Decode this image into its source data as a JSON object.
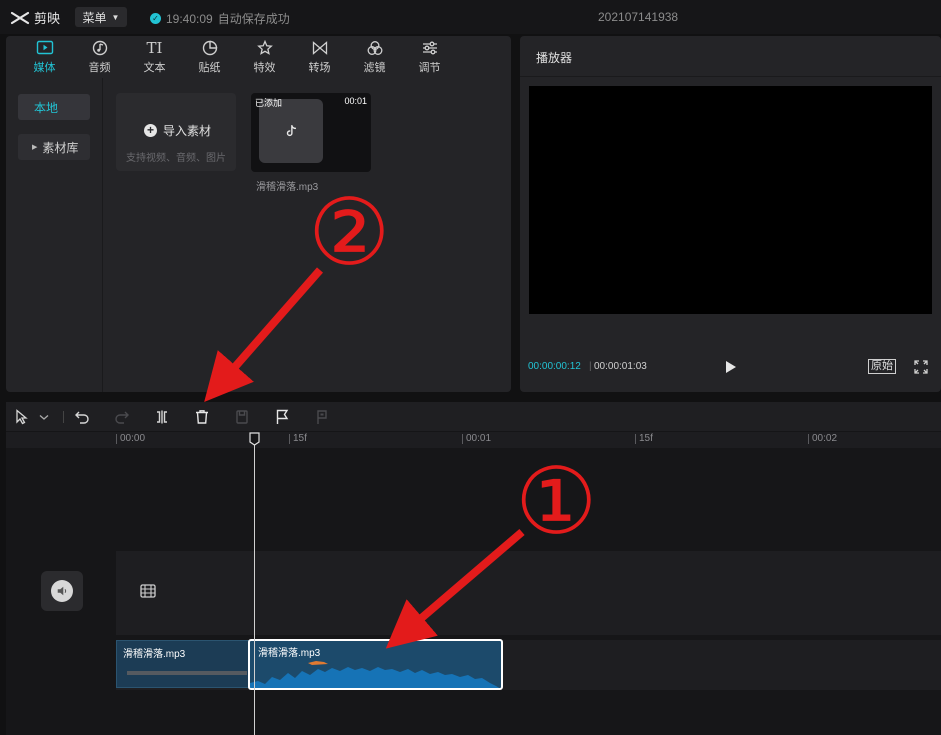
{
  "app": {
    "name": "剪映",
    "menu_label": "菜单",
    "save_time": "19:40:09",
    "save_text": "自动保存成功",
    "project_name": "202107141938"
  },
  "tabs": [
    {
      "label": "媒体",
      "icon": "media-icon",
      "active": true
    },
    {
      "label": "音频",
      "icon": "audio-icon",
      "active": false
    },
    {
      "label": "文本",
      "icon": "text-icon",
      "active": false
    },
    {
      "label": "贴纸",
      "icon": "sticker-icon",
      "active": false
    },
    {
      "label": "特效",
      "icon": "effects-icon",
      "active": false
    },
    {
      "label": "转场",
      "icon": "transition-icon",
      "active": false
    },
    {
      "label": "滤镜",
      "icon": "filter-icon",
      "active": false
    },
    {
      "label": "调节",
      "icon": "adjust-icon",
      "active": false
    }
  ],
  "sidebar": {
    "local": "本地",
    "library": "素材库"
  },
  "import": {
    "title": "导入素材",
    "subtitle": "支持视频、音频、图片"
  },
  "media_item": {
    "added_badge": "已添加",
    "duration": "00:01",
    "name": "滑稽滑落.mp3"
  },
  "player": {
    "title": "播放器",
    "current_time": "00:00:00:12",
    "total_time": "00:00:01:03",
    "original_label": "原始"
  },
  "ruler": [
    "00:00",
    "15f",
    "00:01",
    "15f",
    "00:02"
  ],
  "clips": {
    "clip1_label": "滑稽滑落.mp3",
    "clip2_label": "滑稽滑落.mp3"
  },
  "annotations": {
    "circle1": "①",
    "circle2": "②",
    "color": "#e31b1b"
  },
  "colors": {
    "accent": "#22c3d4",
    "background": "#111112",
    "panel": "#242427",
    "audio_clip": "#1c4a6b",
    "waveform": "#1673b6"
  }
}
